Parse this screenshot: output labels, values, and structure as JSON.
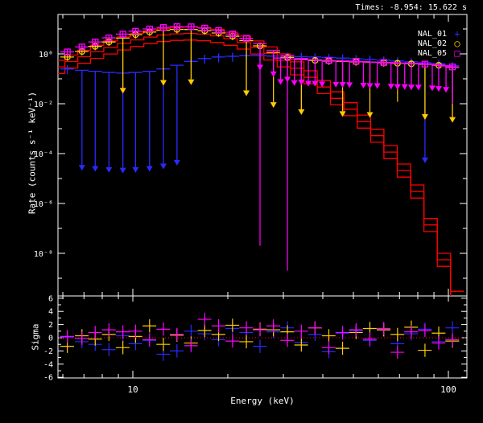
{
  "header": {
    "title": "Times: -8.954: 15.622 s"
  },
  "colors": {
    "background": "#000000",
    "axis": "#ffffff",
    "model": "#ff0000",
    "zero_line": "#ff0000",
    "nal01": "#2a2aff",
    "nal02": "#ffcc00",
    "nal05": "#ff00ff"
  },
  "legend": {
    "entries": [
      {
        "label": "NAL_01",
        "symbol": "plus",
        "glyph": "+",
        "color_key": "nal01"
      },
      {
        "label": "NAL_02",
        "symbol": "circle",
        "glyph": "○",
        "color_key": "nal02"
      },
      {
        "label": "NAL_05",
        "symbol": "square",
        "glyph": "□",
        "color_key": "nal05"
      }
    ]
  },
  "axes": {
    "x_label": "Energy (keV)",
    "y_label": "Rate (counts s⁻¹ keV⁻¹)",
    "sigma_label": "Sigma",
    "x_major": [
      {
        "value": 10,
        "label": "10"
      },
      {
        "value": 100,
        "label": "100"
      }
    ],
    "x_minor": [
      6,
      7,
      8,
      9,
      20,
      30,
      40,
      50,
      60,
      70,
      80,
      90
    ],
    "y_ticks": [
      {
        "exp": 0,
        "label": "10⁰"
      },
      {
        "exp": -2,
        "label": "10⁻²"
      },
      {
        "exp": -4,
        "label": "10⁻⁴"
      },
      {
        "exp": -6,
        "label": "10⁻⁶"
      },
      {
        "exp": -8,
        "label": "10⁻⁸"
      }
    ],
    "sigma_ticks": [
      {
        "v": 6,
        "label": "6"
      },
      {
        "v": 4,
        "label": "4"
      },
      {
        "v": 2,
        "label": "2"
      },
      {
        "v": 0,
        "label": "0"
      },
      {
        "v": -2,
        "label": "-2"
      },
      {
        "v": -4,
        "label": "-4"
      },
      {
        "v": -6,
        "label": "-6"
      }
    ]
  },
  "chart_data": {
    "type": "scatter",
    "title": "Times: -8.954: 15.622 s",
    "xlabel": "Energy (keV)",
    "ylabel": "Rate (counts s⁻¹ keV⁻¹)",
    "x_scale": "log",
    "y_scale": "log",
    "xlim": [
      5.8,
      114
    ],
    "ylim": [
      2e-10,
      40
    ],
    "sigma_ylim": [
      -6.2,
      6.3
    ],
    "grid": false,
    "legend_position": "top-right-inside",
    "bin_half_frac": 0.05,
    "energies": [
      6.2,
      6.9,
      7.6,
      8.4,
      9.3,
      10.2,
      11.3,
      12.5,
      13.8,
      15.3,
      16.9,
      18.7,
      20.7,
      22.9,
      25.3,
      27.9,
      30.9,
      34.2,
      37.8,
      41.8,
      46.2,
      51.0,
      56.4,
      62.4,
      69.0,
      76.3,
      84.3,
      93.2,
      103.0
    ],
    "model": {
      "description": "folded model, stepped line, one per detector",
      "points_kev": [
        5.8,
        6.4,
        7.0,
        7.7,
        8.5,
        9.4,
        10.3,
        11.4,
        12.5,
        13.8,
        15.2,
        16.8,
        18.5,
        20.4,
        22.5,
        24.8,
        27.3,
        30.1,
        33.2,
        36.6,
        40.3,
        44.4,
        49.0,
        54.0,
        59.5,
        65.6,
        72.3,
        79.7,
        87.8,
        96.8,
        106.7
      ],
      "points_rate": [
        0.55,
        0.9,
        1.4,
        2.2,
        3.3,
        4.8,
        6.6,
        8.6,
        10.4,
        11.6,
        12.0,
        11.3,
        9.6,
        7.4,
        5.2,
        3.3,
        1.9,
        1.0,
        0.48,
        0.21,
        0.085,
        0.03,
        0.011,
        0.0035,
        0.00095,
        0.00021,
        3.8e-05,
        5.5e-06,
        2.5e-07,
        1e-08,
        3e-10
      ],
      "detector_scales": [
        1.0,
        0.55,
        0.3
      ]
    },
    "detectors": [
      {
        "name": "NAL_01",
        "symbol": "plus",
        "color_key": "nal01",
        "errs_frac": 0.4,
        "arrow_decades": 3.8,
        "rates": [
          0.25,
          0.22,
          0.2,
          0.18,
          0.17,
          0.18,
          0.2,
          0.25,
          0.35,
          0.5,
          0.65,
          0.75,
          0.8,
          0.85,
          0.85,
          0.82,
          0.8,
          0.78,
          0.75,
          0.72,
          0.68,
          0.64,
          0.6,
          0.56,
          0.52,
          0.48,
          0.44,
          0.4,
          0.34
        ],
        "upper_limit_idx": [
          1,
          2,
          3,
          4,
          5,
          6,
          7,
          8,
          26
        ],
        "deep_bars": {
          "28": 0.012
        },
        "extra_upper_limits": []
      },
      {
        "name": "NAL_02",
        "symbol": "circle",
        "color_key": "nal02",
        "errs_frac": 0.3,
        "arrow_decades": 2.0,
        "rates": [
          0.75,
          1.25,
          2.0,
          3.0,
          4.3,
          5.9,
          7.5,
          8.9,
          9.6,
          9.5,
          8.5,
          6.9,
          5.1,
          3.4,
          2.1,
          1.15,
          0.72,
          0.6,
          0.55,
          0.52,
          0.5,
          0.48,
          0.46,
          0.44,
          0.42,
          0.4,
          0.38,
          0.35,
          0.29
        ],
        "upper_limit_idx": [
          4,
          7,
          9,
          13,
          15,
          17,
          20,
          22,
          26,
          28
        ],
        "deep_bars": {
          "24": 0.012
        },
        "extra_upper_limits": []
      },
      {
        "name": "NAL_05",
        "symbol": "square",
        "color_key": "nal05",
        "errs_frac": 0.28,
        "arrow_decades": 0.85,
        "rates": [
          1.2,
          1.9,
          3.0,
          4.4,
          6.2,
          8.1,
          10.0,
          11.5,
          12.4,
          12.2,
          10.8,
          8.7,
          6.3,
          4.2,
          2.6,
          1.4,
          0.85,
          0.66,
          0.58,
          0.54,
          0.52,
          0.5,
          0.47,
          0.45,
          0.43,
          0.41,
          0.39,
          0.36,
          0.3
        ],
        "upper_limit_idx": [
          14,
          15,
          16,
          17,
          18,
          20,
          22,
          24,
          25,
          27
        ],
        "deep_bars": {
          "14": 2e-08,
          "16": 2e-09,
          "28": 0.01
        },
        "extra_upper_limits": [
          [
            29.4,
            0.68
          ],
          [
            32.5,
            0.62
          ],
          [
            36.0,
            0.58
          ],
          [
            39.8,
            0.55
          ],
          [
            44.0,
            0.53
          ],
          [
            48.6,
            0.51
          ],
          [
            53.8,
            0.49
          ],
          [
            59.5,
            0.47
          ],
          [
            65.8,
            0.45
          ],
          [
            72.7,
            0.43
          ],
          [
            80.4,
            0.41
          ],
          [
            88.9,
            0.38
          ],
          [
            98.3,
            0.33
          ]
        ]
      }
    ],
    "residuals": {
      "ylabel": "Sigma",
      "err": 1.0,
      "series": [
        {
          "name": "NAL_01",
          "color_key": "nal01",
          "sigma": [
            0.1,
            -0.6,
            -1.0,
            -1.8,
            0.3,
            -0.9,
            -0.4,
            -2.5,
            -2.0,
            1.0,
            0.6,
            -0.3,
            1.4,
            0.8,
            -1.3,
            0.9,
            1.5,
            -0.7,
            0.5,
            -2.1,
            0.7,
            1.1,
            -0.4,
            1.2,
            -0.9,
            0.6,
            1.3,
            -0.6,
            1.5
          ]
        },
        {
          "name": "NAL_02",
          "color_key": "nal02",
          "sigma": [
            -1.3,
            0.3,
            -0.2,
            0.5,
            -1.5,
            0.2,
            1.8,
            -1.0,
            0.4,
            -0.8,
            1.1,
            0.5,
            1.9,
            -0.6,
            1.3,
            1.2,
            0.9,
            -1.1,
            1.5,
            0.3,
            -1.6,
            0.8,
            1.4,
            1.2,
            0.5,
            1.6,
            -1.9,
            0.7,
            -0.5
          ]
        },
        {
          "name": "NAL_05",
          "color_key": "nal05",
          "sigma": [
            0.2,
            -0.1,
            0.8,
            1.2,
            0.9,
            1.0,
            -0.3,
            1.3,
            0.5,
            -1.2,
            2.8,
            1.8,
            -0.5,
            1.5,
            1.2,
            1.8,
            -0.4,
            1.0,
            1.5,
            -1.5,
            0.8,
            1.2,
            -0.2,
            1.4,
            -2.2,
            0.9,
            1.1,
            -0.8,
            -0.3
          ]
        }
      ]
    }
  }
}
